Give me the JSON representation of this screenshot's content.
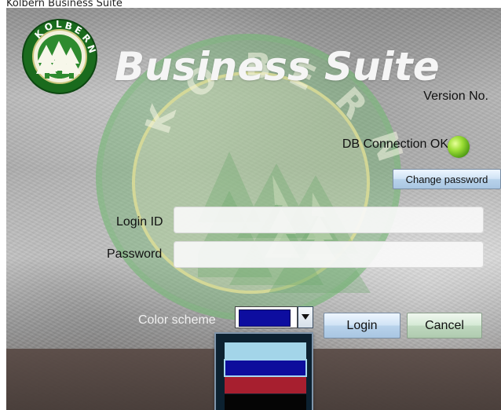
{
  "window": {
    "title_top": "Kolbern Business Suite",
    "brand": {
      "logo_text": "KOLBERN",
      "title": "Business Suite"
    },
    "version_label": "Version No.",
    "db_status": "DB Connection OK",
    "change_password_label": "Change password",
    "login": {
      "id_label": "Login ID",
      "password_label": "Password",
      "id_value": "",
      "password_value": ""
    },
    "color_scheme_label": "Color scheme",
    "login_button": "Login",
    "cancel_button": "Cancel",
    "color_scheme": {
      "selected": "#0d0d9f",
      "options": [
        "#a3d5e9",
        "#0d0d9c",
        "#a71f2f",
        "#050505"
      ]
    },
    "status_color": "#8fd12f"
  }
}
